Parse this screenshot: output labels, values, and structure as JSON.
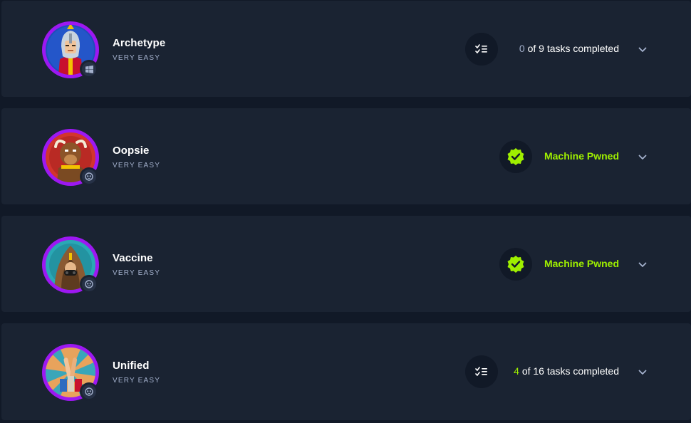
{
  "colors": {
    "card_bg": "#1a2332",
    "page_bg": "#111927",
    "ring": "#9d18f2",
    "accent_green": "#9fef00",
    "muted": "#a4b1cd"
  },
  "machines": [
    {
      "name": "Archetype",
      "difficulty": "VERY EASY",
      "os_icon": "windows-icon",
      "status": "tasks",
      "tasks_done": "0",
      "tasks_rest": "of 9 tasks completed"
    },
    {
      "name": "Oopsie",
      "difficulty": "VERY EASY",
      "os_icon": "linux-icon",
      "status": "pwned",
      "pwned_label": "Machine Pwned"
    },
    {
      "name": "Vaccine",
      "difficulty": "VERY EASY",
      "os_icon": "linux-icon",
      "status": "pwned",
      "pwned_label": "Machine Pwned"
    },
    {
      "name": "Unified",
      "difficulty": "VERY EASY",
      "os_icon": "linux-icon",
      "status": "tasks",
      "tasks_done": "4",
      "tasks_rest": "of 16 tasks completed"
    }
  ]
}
